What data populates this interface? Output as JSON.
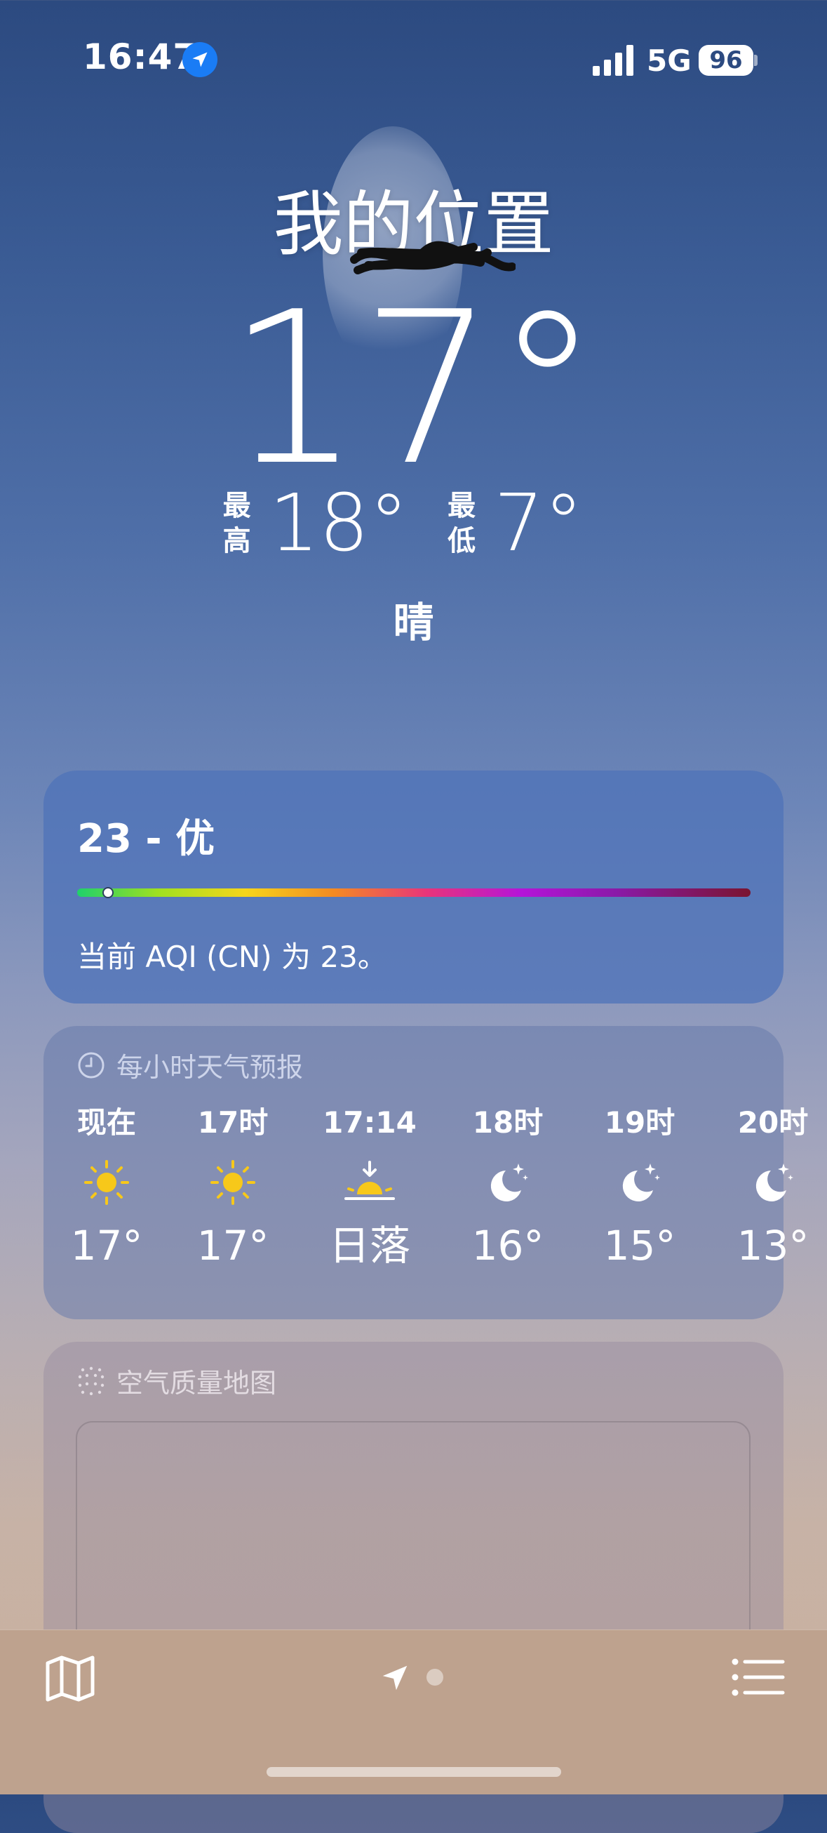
{
  "status_bar": {
    "time": "16:47",
    "network": "5G",
    "battery": "96"
  },
  "header": {
    "location": "我的位置",
    "current_temp": "17°",
    "high_label_1": "最",
    "high_label_2": "高",
    "high": "18°",
    "low_label_1": "最",
    "low_label_2": "低",
    "low": "7°",
    "condition": "晴"
  },
  "aqi": {
    "value_text": "23 - 优",
    "level": 23,
    "description": "当前 AQI (CN) 为 23。"
  },
  "hourly": {
    "title": "每小时天气预报",
    "items": [
      {
        "label": "现在",
        "icon": "sun-icon",
        "value": "17°"
      },
      {
        "label": "17时",
        "icon": "sun-icon",
        "value": "17°"
      },
      {
        "label": "17:14",
        "icon": "sunset-icon",
        "value": "日落"
      },
      {
        "label": "18时",
        "icon": "moon-stars-icon",
        "value": "16°"
      },
      {
        "label": "19时",
        "icon": "moon-stars-icon",
        "value": "15°"
      },
      {
        "label": "20时",
        "icon": "moon-stars-icon",
        "value": "13°"
      }
    ]
  },
  "air_map": {
    "title": "空气质量地图"
  },
  "colors": {
    "sun": "#f7c81a",
    "accent": "#1a7cf5",
    "bottom_bar": "#bea28e"
  }
}
